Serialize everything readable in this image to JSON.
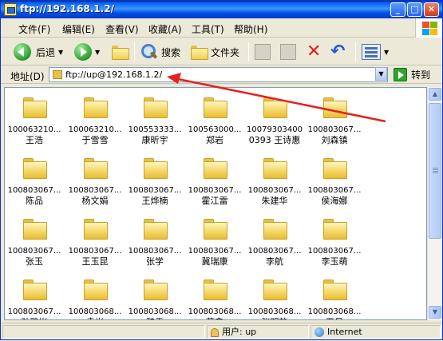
{
  "window": {
    "title": "ftp://192.168.1.2/"
  },
  "menu": [
    "文件(F)",
    "编辑(E)",
    "查看(V)",
    "收藏(A)",
    "工具(T)",
    "帮助(H)"
  ],
  "toolbar": {
    "back_label": "后退",
    "search_label": "搜索",
    "folders_label": "文件夹"
  },
  "address": {
    "label": "地址(D)",
    "value": "ftp://up@192.168.1.2/",
    "go_label": "转到"
  },
  "folders": [
    {
      "id": "100063210...",
      "name": "王浩"
    },
    {
      "id": "100063210...",
      "name": "于雪雪"
    },
    {
      "id": "100553333...",
      "name": "康昕宇"
    },
    {
      "id": "100563000...",
      "name": "郑岩"
    },
    {
      "id": "10079303400",
      "name": "0393 王诗惠"
    },
    {
      "id": "100803067...",
      "name": "刘森镇"
    },
    {
      "id": "100803067...",
      "name": "陈品"
    },
    {
      "id": "100803067...",
      "name": "杨文娟"
    },
    {
      "id": "100803067...",
      "name": "王烨楠"
    },
    {
      "id": "100803067...",
      "name": "霍江雷"
    },
    {
      "id": "100803067...",
      "name": "朱建华"
    },
    {
      "id": "100803067...",
      "name": "侯海娜"
    },
    {
      "id": "100803067...",
      "name": "张玉"
    },
    {
      "id": "100803067...",
      "name": "王玉昆"
    },
    {
      "id": "100803067...",
      "name": "张学"
    },
    {
      "id": "100803067...",
      "name": "冀瑞康"
    },
    {
      "id": "100803067...",
      "name": "李航"
    },
    {
      "id": "100803067...",
      "name": "李玉萌"
    },
    {
      "id": "100803067...",
      "name": "孙雅彬"
    },
    {
      "id": "100803068...",
      "name": "袁彬"
    },
    {
      "id": "100803068...",
      "name": "魏雪"
    },
    {
      "id": "100803068...",
      "name": "葛鑫"
    },
    {
      "id": "100803068...",
      "name": "张明静"
    },
    {
      "id": "100803068...",
      "name": "王丹"
    }
  ],
  "status": {
    "user": "用户: up",
    "zone": "Internet"
  }
}
